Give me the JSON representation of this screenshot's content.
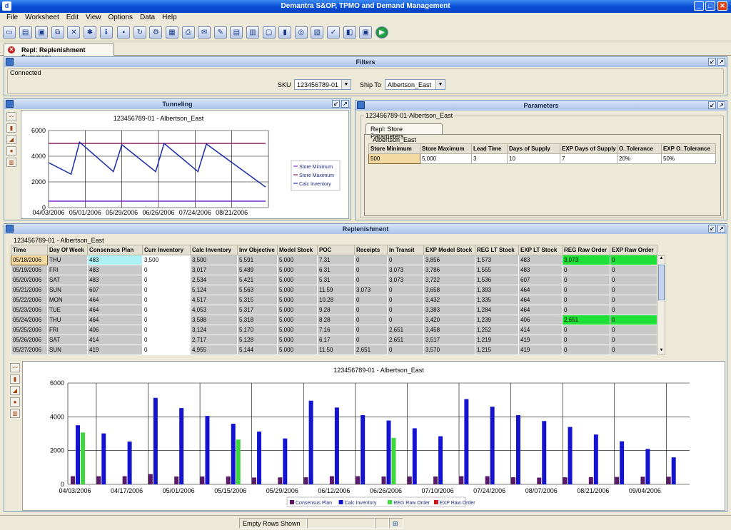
{
  "window": {
    "title": "Demantra S&OP, TPMO and Demand Management"
  },
  "menu": [
    "File",
    "Worksheet",
    "Edit",
    "View",
    "Options",
    "Data",
    "Help"
  ],
  "toolbar": {
    "icons": [
      "new-icon",
      "open-icon",
      "save-icon",
      "copy-icon",
      "delete-icon",
      "wizard-icon",
      "info-icon",
      "disabled-icon",
      "refresh-icon",
      "filter-icon",
      "calculator-icon",
      "print-icon",
      "email-icon",
      "export-icon",
      "layout-icon",
      "views-icon",
      "window-icon",
      "chart-icon",
      "tools-icon",
      "settings-icon",
      "options-icon",
      "bookmark-icon",
      "panel-icon",
      "go-icon"
    ]
  },
  "tab": {
    "label": "Repl: Replenishment Summary"
  },
  "filters": {
    "title": "Filters",
    "status": "Connected",
    "sku_label": "SKU",
    "sku_value": "123456789-01",
    "shipto_label": "Ship To",
    "shipto_value": "Albertson_East"
  },
  "tunneling": {
    "title": "Tunneling"
  },
  "parameters": {
    "title": "Parameters",
    "group": "123456789-01-Albertson_East",
    "subtab": "Repl: Store Parameters",
    "location": "Albertson_East",
    "headers": [
      "Store Minimum",
      "Store Maximum",
      "Lead Time",
      "Days of Supply",
      "EXP Days of Supply",
      "O_Tolerance",
      "EXP O_Tolerance"
    ],
    "row": [
      "500",
      "5,000",
      "3",
      "10",
      "7",
      "20%",
      "50%"
    ]
  },
  "replenishment": {
    "title": "Replenishment",
    "group": "123456789-01 - Albertson_East",
    "headers": [
      "Time",
      "Day Of Week",
      "Consensus Plan",
      "Curr Inventory",
      "Calc Inventory",
      "Inv Objective",
      "Model Stock",
      "POC",
      "Receipts",
      "In Transit",
      "EXP Model Stock",
      "REG LT Stock",
      "EXP LT Stock",
      "REG Raw Order",
      "EXP Raw Order"
    ],
    "rows": [
      [
        "05/18/2006",
        "THU",
        "483",
        "3,500",
        "3,500",
        "5,591",
        "5,000",
        "7.31",
        "0",
        "0",
        "3,856",
        "1,573",
        "483",
        "3,073",
        "0"
      ],
      [
        "05/19/2006",
        "FRI",
        "483",
        "0",
        "3,017",
        "5,489",
        "5,000",
        "6.31",
        "0",
        "3,073",
        "3,786",
        "1,555",
        "483",
        "0",
        "0"
      ],
      [
        "05/20/2006",
        "SAT",
        "483",
        "0",
        "2,534",
        "5,421",
        "5,000",
        "5.31",
        "0",
        "3,073",
        "3,722",
        "1,536",
        "607",
        "0",
        "0"
      ],
      [
        "05/21/2006",
        "SUN",
        "607",
        "0",
        "5,124",
        "5,563",
        "5,000",
        "11.59",
        "3,073",
        "0",
        "3,658",
        "1,393",
        "464",
        "0",
        "0"
      ],
      [
        "05/22/2006",
        "MON",
        "464",
        "0",
        "4,517",
        "5,315",
        "5,000",
        "10.28",
        "0",
        "0",
        "3,432",
        "1,335",
        "464",
        "0",
        "0"
      ],
      [
        "05/23/2006",
        "TUE",
        "464",
        "0",
        "4,053",
        "5,317",
        "5,000",
        "9.28",
        "0",
        "0",
        "3,383",
        "1,284",
        "464",
        "0",
        "0"
      ],
      [
        "05/24/2006",
        "THU",
        "464",
        "0",
        "3,588",
        "5,318",
        "5,000",
        "8.28",
        "0",
        "0",
        "3,420",
        "1,239",
        "406",
        "2,651",
        "0"
      ],
      [
        "05/25/2006",
        "FRI",
        "406",
        "0",
        "3,124",
        "5,170",
        "5,000",
        "7.16",
        "0",
        "2,651",
        "3,458",
        "1,252",
        "414",
        "0",
        "0"
      ],
      [
        "05/26/2006",
        "SAT",
        "414",
        "0",
        "2,717",
        "5,128",
        "5,000",
        "6.17",
        "0",
        "2,651",
        "3,517",
        "1,219",
        "419",
        "0",
        "0"
      ],
      [
        "05/27/2006",
        "SUN",
        "419",
        "0",
        "4,955",
        "5,144",
        "5,000",
        "11.50",
        "2,651",
        "0",
        "3,570",
        "1,215",
        "419",
        "0",
        "0"
      ]
    ]
  },
  "status": {
    "text": "Empty Rows Shown"
  },
  "chart_data": [
    {
      "type": "line",
      "title": "123456789-01 - Albertson_East",
      "ylim": [
        0,
        6000
      ],
      "yticks": [
        0,
        2000,
        4000,
        6000
      ],
      "xticks": [
        "04/03/2006",
        "05/01/2006",
        "05/29/2006",
        "06/26/2006",
        "07/24/2006",
        "08/21/2006"
      ],
      "x": [
        0,
        8,
        11,
        23,
        26,
        38,
        41,
        53,
        56,
        77
      ],
      "series": [
        {
          "name": "Store Minimum",
          "color": "#7a2bd6",
          "values": [
            500,
            500,
            500,
            500,
            500,
            500,
            500,
            500,
            500,
            500
          ]
        },
        {
          "name": "Store Maximum",
          "color": "#8a1a5a",
          "values": [
            5000,
            5000,
            5000,
            5000,
            5000,
            5000,
            5000,
            5000,
            5000,
            5000
          ]
        },
        {
          "name": "Calc Inventory",
          "color": "#1a2aa8",
          "values": [
            3500,
            2600,
            5100,
            2800,
            4900,
            2800,
            5000,
            2800,
            4950,
            1600
          ]
        }
      ],
      "x_domain": [
        0,
        78
      ],
      "legend": "right",
      "grid": true
    },
    {
      "type": "bar",
      "title": "123456789-01 - Albertson_East",
      "ylim": [
        0,
        6000
      ],
      "yticks": [
        0,
        2000,
        4000,
        6000
      ],
      "xticks": [
        "04/03/2006",
        "04/17/2006",
        "05/01/2006",
        "05/15/2006",
        "05/29/2006",
        "06/12/2006",
        "06/26/2006",
        "07/10/2006",
        "07/24/2006",
        "08/07/2006",
        "08/21/2006",
        "09/04/2006"
      ],
      "legend": "bottom",
      "grid": true,
      "series": [
        {
          "name": "Consensus Plan",
          "color": "#5a1a6a",
          "values": [
            483,
            483,
            483,
            607,
            464,
            464,
            464,
            406,
            414,
            419,
            483,
            483,
            464,
            464,
            464,
            483,
            483,
            420,
            400,
            420,
            430,
            440,
            450,
            450
          ]
        },
        {
          "name": "Calc Inventory",
          "color": "#1414d0",
          "values": [
            3500,
            3017,
            2534,
            5124,
            4517,
            4053,
            3588,
            3124,
            2717,
            4955,
            4550,
            4100,
            3780,
            3320,
            2850,
            5050,
            4600,
            4100,
            3750,
            3400,
            2950,
            2550,
            2100,
            1600
          ]
        },
        {
          "name": "REG Raw Order",
          "color": "#3cd83c",
          "values": [
            3073,
            0,
            0,
            0,
            0,
            0,
            2651,
            0,
            0,
            0,
            0,
            0,
            2750,
            0,
            0,
            0,
            0,
            0,
            0,
            0,
            0,
            0,
            0,
            0
          ]
        },
        {
          "name": "EXP Raw Order",
          "color": "#c81818",
          "values": [
            0,
            0,
            0,
            0,
            0,
            0,
            0,
            0,
            0,
            0,
            0,
            0,
            0,
            0,
            0,
            0,
            0,
            0,
            0,
            0,
            0,
            0,
            0,
            0
          ]
        }
      ]
    }
  ]
}
